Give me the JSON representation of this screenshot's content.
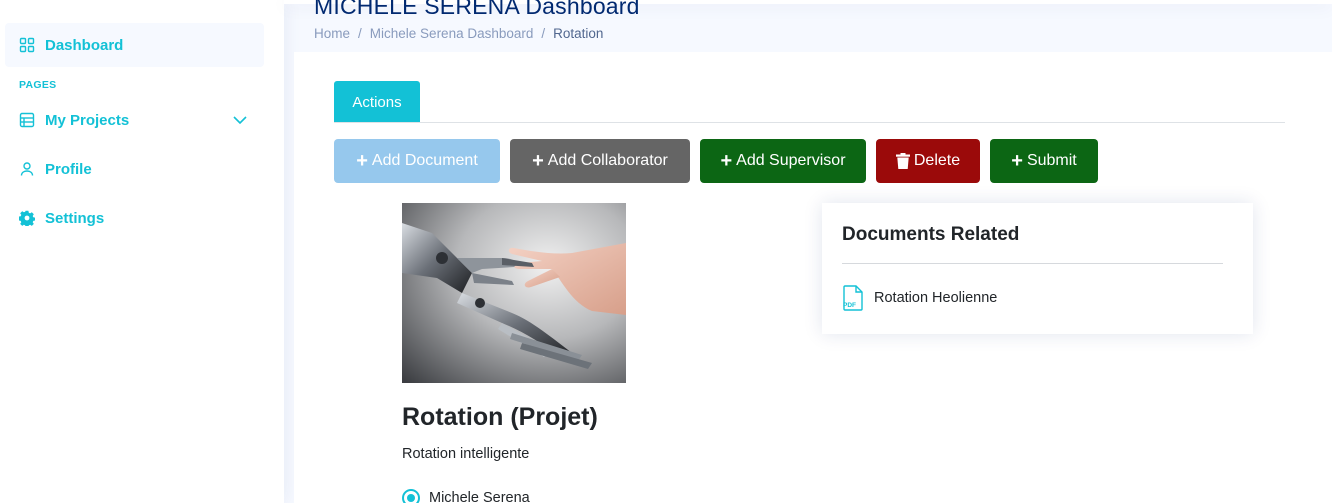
{
  "sidebar": {
    "items": [
      {
        "label": "Dashboard",
        "icon": "grid-icon"
      },
      {
        "label": "My Projects",
        "icon": "layout-list-icon"
      },
      {
        "label": "Profile",
        "icon": "person-icon"
      },
      {
        "label": "Settings",
        "icon": "gear-icon"
      }
    ],
    "heading": "PAGES"
  },
  "header": {
    "title": "MICHELE SERENA Dashboard",
    "breadcrumb": [
      "Home",
      "Michele Serena Dashboard",
      "Rotation"
    ]
  },
  "tabs": [
    {
      "label": "Actions"
    }
  ],
  "actions": {
    "add_document": "Add Document",
    "add_collaborator": "Add Collaborator",
    "add_supervisor": "Add Supervisor",
    "delete": "Delete",
    "submit": "Submit"
  },
  "project": {
    "title": "Rotation (Projet)",
    "description": "Rotation intelligente",
    "member": "Michele Serena"
  },
  "documents": {
    "title": "Documents Related",
    "items": [
      {
        "name": "Rotation Heolienne",
        "icon": "pdf-file-icon",
        "icon_text": "PDF"
      }
    ]
  },
  "colors": {
    "accent": "#13c1d6",
    "title": "#012970",
    "add_document": "#96c8ed",
    "add_collaborator": "#656565",
    "add_supervisor": "#0c6614",
    "delete": "#9b0a0a",
    "submit": "#0c6614"
  }
}
